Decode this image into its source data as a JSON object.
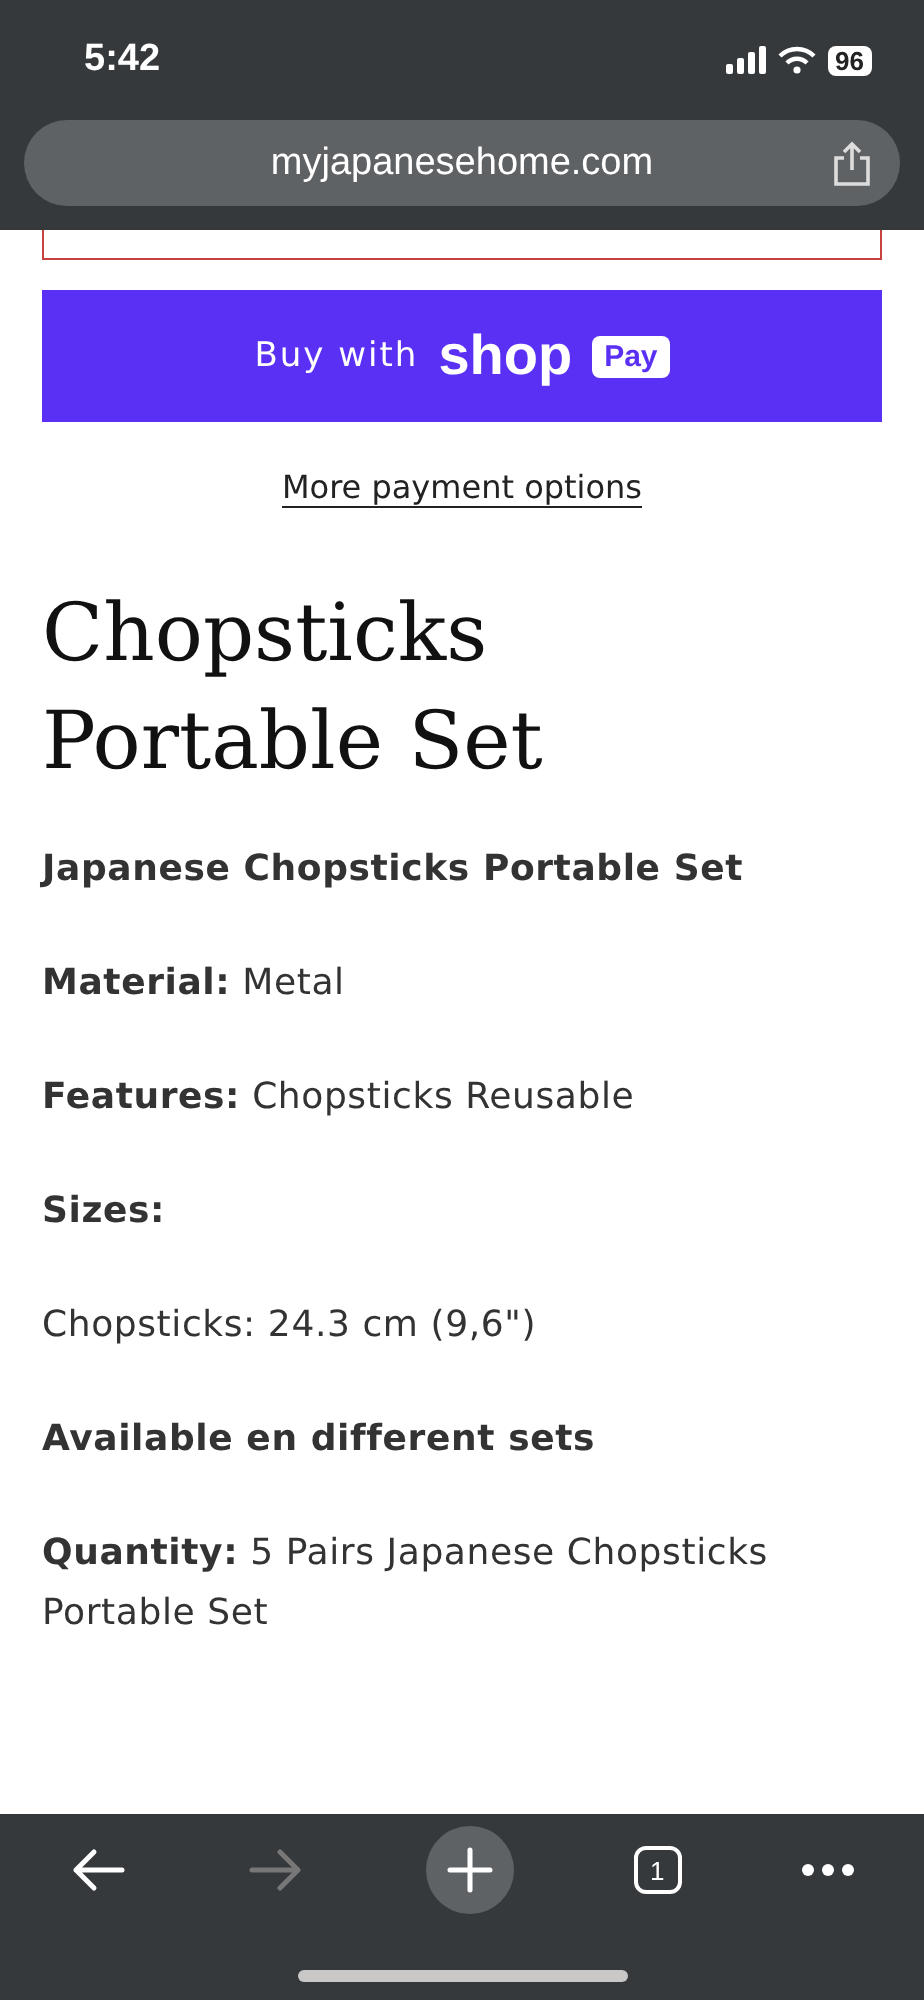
{
  "status_bar": {
    "time": "5:42",
    "battery": "96"
  },
  "address_bar": {
    "url": "myjapanesehome.com"
  },
  "buy_button": {
    "prefix": "Buy with",
    "brand": "shop",
    "badge": "Pay"
  },
  "more_payment_link": "More payment options",
  "product_title": "Chopsticks Portable Set",
  "description": [
    {
      "kind": "heading",
      "text": "Japanese Chopsticks Portable Set"
    },
    {
      "kind": "text",
      "text": "**Material:** Metal"
    },
    {
      "kind": "text",
      "text": "**Features:** Chopsticks Reusable"
    },
    {
      "kind": "heading",
      "text": "Sizes:"
    },
    {
      "kind": "text",
      "text": "Chopsticks: 24.3 cm (9,6\")"
    },
    {
      "kind": "heading",
      "text": "Available en different sets"
    },
    {
      "kind": "text",
      "text": "**Quantity:** 5 Pairs Japanese Chopsticks Portable Set"
    }
  ],
  "toolbar": {
    "back_disabled": false,
    "forward_disabled": true,
    "tab_count": "1"
  }
}
